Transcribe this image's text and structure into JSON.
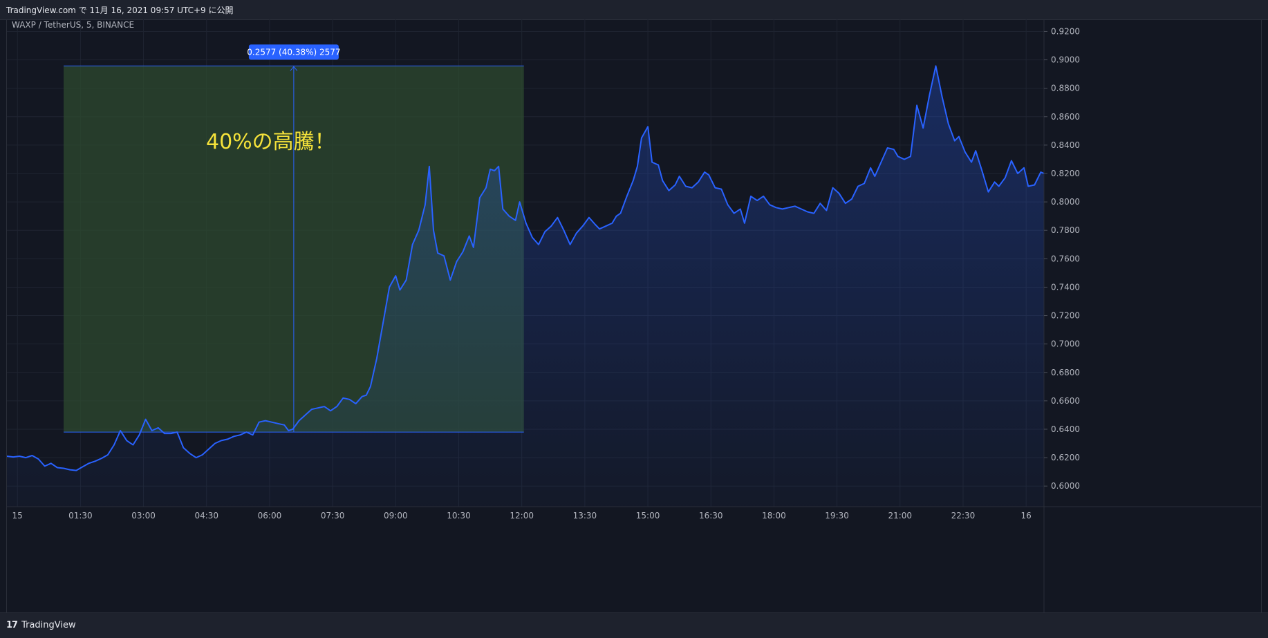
{
  "header": {
    "publish_line": "TradingView.com で 11月 16, 2021 09:57 UTC+9 に公開"
  },
  "footer": {
    "logo_mark": "17",
    "logo_text": "TradingView"
  },
  "colors": {
    "line": "#2962ff",
    "measure_fill": "#2e4a2f",
    "badge": "#2962ff",
    "annotation": "#f5e23a"
  },
  "chart_data": {
    "type": "area",
    "symbol_label": "WAXP / TetherUS, 5, BINANCE",
    "annotation": "40%の高騰！",
    "measure_label": "0.2577 (40.38%) 2577",
    "measure_range": {
      "from_x": 2.7,
      "to_x": 24.6,
      "low": 0.638,
      "high": 0.8957
    },
    "ylim": [
      0.5855,
      0.9285
    ],
    "xlim": [
      0,
      49.35
    ],
    "y_ticks": [
      "0.6000",
      "0.6200",
      "0.6400",
      "0.6600",
      "0.6800",
      "0.7000",
      "0.7200",
      "0.7400",
      "0.7600",
      "0.7800",
      "0.8000",
      "0.8200",
      "0.8400",
      "0.8600",
      "0.8800",
      "0.9000",
      "0.9200"
    ],
    "x_ticks": [
      {
        "label": "15",
        "x": 0.5
      },
      {
        "label": "01:30",
        "x": 3.5
      },
      {
        "label": "03:00",
        "x": 6.5
      },
      {
        "label": "04:30",
        "x": 9.5
      },
      {
        "label": "06:00",
        "x": 12.5
      },
      {
        "label": "07:30",
        "x": 15.5
      },
      {
        "label": "09:00",
        "x": 18.5
      },
      {
        "label": "10:30",
        "x": 21.5
      },
      {
        "label": "12:00",
        "x": 24.5
      },
      {
        "label": "13:30",
        "x": 27.5
      },
      {
        "label": "15:00",
        "x": 30.5
      },
      {
        "label": "16:30",
        "x": 33.5
      },
      {
        "label": "18:00",
        "x": 36.5
      },
      {
        "label": "19:30",
        "x": 39.5
      },
      {
        "label": "21:00",
        "x": 42.5
      },
      {
        "label": "22:30",
        "x": 45.5
      },
      {
        "label": "16",
        "x": 48.5
      }
    ],
    "series": [
      {
        "points": [
          [
            0.0,
            0.621
          ],
          [
            0.3,
            0.6205
          ],
          [
            0.6,
            0.621
          ],
          [
            0.9,
            0.62
          ],
          [
            1.2,
            0.6215
          ],
          [
            1.5,
            0.619
          ],
          [
            1.8,
            0.614
          ],
          [
            2.1,
            0.616
          ],
          [
            2.4,
            0.613
          ],
          [
            2.7,
            0.6125
          ],
          [
            3.0,
            0.6115
          ],
          [
            3.3,
            0.611
          ],
          [
            3.6,
            0.6135
          ],
          [
            3.9,
            0.616
          ],
          [
            4.2,
            0.6175
          ],
          [
            4.5,
            0.6195
          ],
          [
            4.8,
            0.622
          ],
          [
            5.1,
            0.629
          ],
          [
            5.4,
            0.639
          ],
          [
            5.7,
            0.632
          ],
          [
            6.0,
            0.629
          ],
          [
            6.3,
            0.636
          ],
          [
            6.6,
            0.647
          ],
          [
            6.9,
            0.639
          ],
          [
            7.2,
            0.641
          ],
          [
            7.5,
            0.637
          ],
          [
            7.8,
            0.637
          ],
          [
            8.1,
            0.638
          ],
          [
            8.4,
            0.627
          ],
          [
            8.7,
            0.623
          ],
          [
            9.0,
            0.62
          ],
          [
            9.3,
            0.622
          ],
          [
            9.6,
            0.626
          ],
          [
            9.9,
            0.63
          ],
          [
            10.2,
            0.632
          ],
          [
            10.5,
            0.633
          ],
          [
            10.8,
            0.635
          ],
          [
            11.1,
            0.636
          ],
          [
            11.4,
            0.638
          ],
          [
            11.7,
            0.636
          ],
          [
            12.0,
            0.645
          ],
          [
            12.3,
            0.646
          ],
          [
            12.6,
            0.645
          ],
          [
            12.9,
            0.644
          ],
          [
            13.2,
            0.643
          ],
          [
            13.4,
            0.639
          ],
          [
            13.6,
            0.64
          ],
          [
            13.9,
            0.646
          ],
          [
            14.2,
            0.65
          ],
          [
            14.5,
            0.654
          ],
          [
            14.8,
            0.655
          ],
          [
            15.1,
            0.656
          ],
          [
            15.4,
            0.653
          ],
          [
            15.7,
            0.656
          ],
          [
            16.0,
            0.662
          ],
          [
            16.3,
            0.661
          ],
          [
            16.6,
            0.658
          ],
          [
            16.9,
            0.663
          ],
          [
            17.1,
            0.664
          ],
          [
            17.3,
            0.67
          ],
          [
            17.6,
            0.69
          ],
          [
            17.9,
            0.715
          ],
          [
            18.2,
            0.74
          ],
          [
            18.5,
            0.748
          ],
          [
            18.7,
            0.738
          ],
          [
            19.0,
            0.745
          ],
          [
            19.3,
            0.77
          ],
          [
            19.6,
            0.78
          ],
          [
            19.9,
            0.798
          ],
          [
            20.1,
            0.825
          ],
          [
            20.3,
            0.78
          ],
          [
            20.5,
            0.764
          ],
          [
            20.8,
            0.762
          ],
          [
            21.1,
            0.745
          ],
          [
            21.4,
            0.758
          ],
          [
            21.7,
            0.765
          ],
          [
            22.0,
            0.776
          ],
          [
            22.2,
            0.768
          ],
          [
            22.5,
            0.803
          ],
          [
            22.8,
            0.81
          ],
          [
            23.0,
            0.823
          ],
          [
            23.2,
            0.822
          ],
          [
            23.4,
            0.825
          ],
          [
            23.6,
            0.795
          ],
          [
            23.9,
            0.79
          ],
          [
            24.2,
            0.787
          ],
          [
            24.4,
            0.8
          ],
          [
            24.7,
            0.785
          ],
          [
            25.0,
            0.775
          ],
          [
            25.3,
            0.77
          ],
          [
            25.6,
            0.779
          ],
          [
            25.9,
            0.783
          ],
          [
            26.2,
            0.789
          ],
          [
            26.5,
            0.78
          ],
          [
            26.8,
            0.77
          ],
          [
            27.1,
            0.778
          ],
          [
            27.4,
            0.783
          ],
          [
            27.7,
            0.789
          ],
          [
            28.0,
            0.784
          ],
          [
            28.2,
            0.781
          ],
          [
            28.5,
            0.783
          ],
          [
            28.8,
            0.785
          ],
          [
            29.0,
            0.79
          ],
          [
            29.2,
            0.792
          ],
          [
            29.5,
            0.804
          ],
          [
            29.8,
            0.815
          ],
          [
            30.0,
            0.825
          ],
          [
            30.2,
            0.845
          ],
          [
            30.5,
            0.853
          ],
          [
            30.7,
            0.828
          ],
          [
            31.0,
            0.826
          ],
          [
            31.2,
            0.815
          ],
          [
            31.5,
            0.808
          ],
          [
            31.8,
            0.812
          ],
          [
            32.0,
            0.818
          ],
          [
            32.3,
            0.811
          ],
          [
            32.6,
            0.81
          ],
          [
            32.9,
            0.814
          ],
          [
            33.2,
            0.821
          ],
          [
            33.4,
            0.819
          ],
          [
            33.7,
            0.81
          ],
          [
            34.0,
            0.809
          ],
          [
            34.3,
            0.798
          ],
          [
            34.6,
            0.792
          ],
          [
            34.9,
            0.795
          ],
          [
            35.1,
            0.785
          ],
          [
            35.4,
            0.804
          ],
          [
            35.7,
            0.801
          ],
          [
            36.0,
            0.804
          ],
          [
            36.3,
            0.798
          ],
          [
            36.6,
            0.796
          ],
          [
            36.9,
            0.795
          ],
          [
            37.2,
            0.796
          ],
          [
            37.5,
            0.797
          ],
          [
            37.8,
            0.795
          ],
          [
            38.1,
            0.793
          ],
          [
            38.4,
            0.792
          ],
          [
            38.7,
            0.799
          ],
          [
            39.0,
            0.794
          ],
          [
            39.3,
            0.81
          ],
          [
            39.6,
            0.806
          ],
          [
            39.9,
            0.799
          ],
          [
            40.2,
            0.802
          ],
          [
            40.5,
            0.811
          ],
          [
            40.8,
            0.813
          ],
          [
            41.1,
            0.824
          ],
          [
            41.3,
            0.818
          ],
          [
            41.6,
            0.828
          ],
          [
            41.9,
            0.838
          ],
          [
            42.2,
            0.837
          ],
          [
            42.4,
            0.832
          ],
          [
            42.7,
            0.83
          ],
          [
            43.0,
            0.832
          ],
          [
            43.3,
            0.868
          ],
          [
            43.6,
            0.852
          ],
          [
            43.9,
            0.875
          ],
          [
            44.2,
            0.8957
          ],
          [
            44.5,
            0.874
          ],
          [
            44.8,
            0.855
          ],
          [
            45.1,
            0.843
          ],
          [
            45.3,
            0.846
          ],
          [
            45.6,
            0.835
          ]
        ]
      },
      {
        "points": [
          [
            45.6,
            0.835
          ],
          [
            45.9,
            0.828
          ],
          [
            46.1,
            0.836
          ],
          [
            46.4,
            0.822
          ],
          [
            46.7,
            0.807
          ],
          [
            47.0,
            0.814
          ],
          [
            47.2,
            0.811
          ],
          [
            47.5,
            0.817
          ],
          [
            47.8,
            0.829
          ],
          [
            48.1,
            0.82
          ],
          [
            48.4,
            0.824
          ],
          [
            48.6,
            0.811
          ],
          [
            48.9,
            0.812
          ],
          [
            49.2,
            0.821
          ],
          [
            49.35,
            0.82
          ]
        ]
      }
    ]
  }
}
